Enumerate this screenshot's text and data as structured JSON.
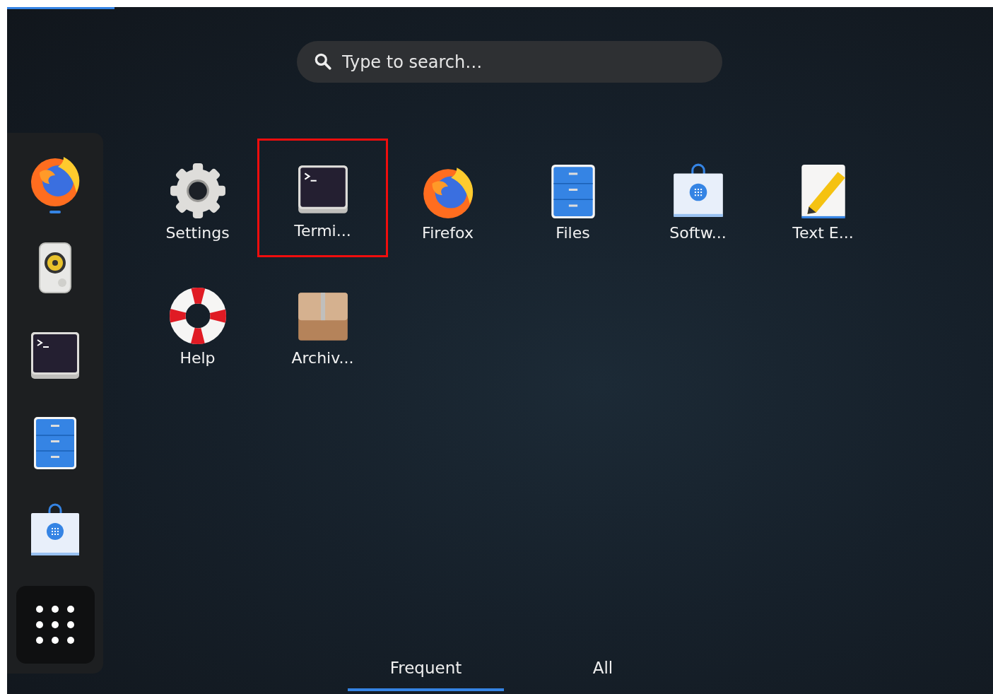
{
  "search": {
    "placeholder": "Type to search…"
  },
  "dock": {
    "items": [
      {
        "kind": "firefox",
        "running": true
      },
      {
        "kind": "speaker",
        "running": false
      },
      {
        "kind": "terminal",
        "running": false
      },
      {
        "kind": "files",
        "running": false
      },
      {
        "kind": "software",
        "running": false
      }
    ]
  },
  "apps": [
    {
      "kind": "settings",
      "label": "Settings",
      "highlighted": false
    },
    {
      "kind": "terminal",
      "label": "Termi...",
      "highlighted": true
    },
    {
      "kind": "firefox",
      "label": "Firefox",
      "highlighted": false
    },
    {
      "kind": "files",
      "label": "Files",
      "highlighted": false
    },
    {
      "kind": "software",
      "label": "Softw...",
      "highlighted": false
    },
    {
      "kind": "texteditor",
      "label": "Text E...",
      "highlighted": false
    },
    {
      "kind": "help",
      "label": "Help",
      "highlighted": false
    },
    {
      "kind": "archive",
      "label": "Archiv...",
      "highlighted": false
    }
  ],
  "tabs": [
    {
      "label": "Frequent",
      "selected": true
    },
    {
      "label": "All",
      "selected": false
    }
  ]
}
